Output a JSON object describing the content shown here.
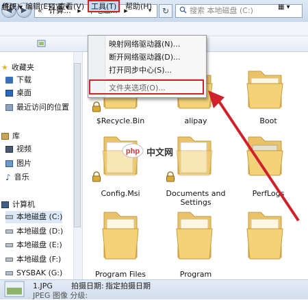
{
  "address": {
    "segments": [
      "计算...",
      "本地磁...",
      "▸"
    ],
    "search_placeholder": "搜索 本地磁盘 (C:)"
  },
  "menubar": {
    "file": "件(F)",
    "edit": "编辑(E)",
    "view": "查看(V)",
    "tools": "工具(T)",
    "help": "帮助(H)"
  },
  "toolbar": {
    "organize": "组织 ▾",
    "preview": "预览 ▾"
  },
  "tools_menu": {
    "items": [
      "映射网络驱动器(N)...",
      "断开网络驱动器(D)...",
      "打开同步中心(S)...",
      "文件夹选项(O)..."
    ]
  },
  "nav": {
    "favorites": "收藏夹",
    "downloads": "下载",
    "desktop": "桌面",
    "recent": "最近访问的位置",
    "libraries": "库",
    "videos": "视频",
    "pictures": "图片",
    "music": "音乐",
    "computer": "计算机",
    "drives": [
      "本地磁盘 (C:)",
      "本地磁盘 (D:)",
      "本地磁盘 (E:)",
      "本地磁盘 (F:)",
      "SYSBAK (G:)"
    ]
  },
  "folders": {
    "recycle": "$Recycle.Bin",
    "alipay": "alipay",
    "boot": "Boot",
    "config": "Config.Msi",
    "documents_line1": "Documents and",
    "documents_line2": "Settings",
    "perflogs": "PerfLogs",
    "program_files": "Program Files",
    "program_x86": "Program"
  },
  "status": {
    "filename": "1.JPG",
    "date_label": "拍摄日期:",
    "date_value": "指定拍摄日期",
    "line2": "JPEG 图像     分级:"
  },
  "watermark": "php 中文网",
  "colors": {
    "highlight_red": "#d0202a",
    "folder_yellow": "#f3d27a",
    "accent_blue": "#c6dcf5"
  }
}
